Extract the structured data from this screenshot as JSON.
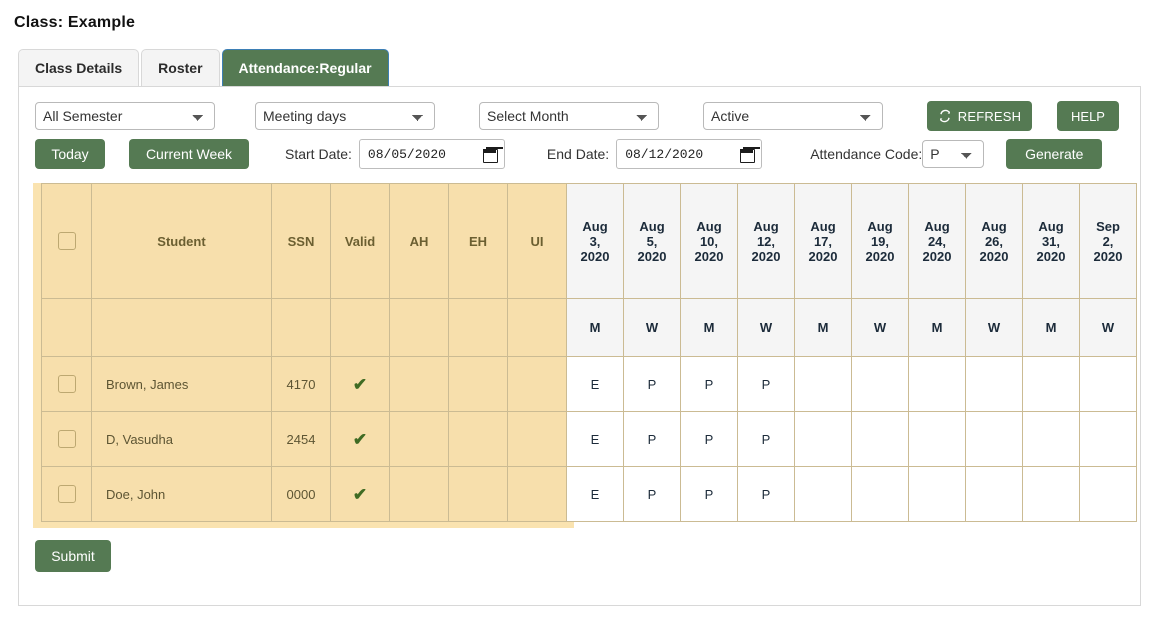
{
  "page": {
    "title": "Class: Example"
  },
  "tabs": [
    {
      "label": "Class Details",
      "active": false
    },
    {
      "label": "Roster",
      "active": false
    },
    {
      "label": "Attendance:Regular",
      "active": true
    }
  ],
  "toolbar": {
    "semester_select": {
      "value": "All Semester",
      "name": "semester-select"
    },
    "meeting_select": {
      "value": "Meeting days",
      "name": "meeting-days-select"
    },
    "month_select": {
      "value": "Select Month",
      "name": "month-select"
    },
    "status_select": {
      "value": "Active",
      "name": "status-select"
    },
    "refresh_label": "REFRESH",
    "refresh_icon": "refresh-icon",
    "help_label": "HELP",
    "today_label": "Today",
    "current_week_label": "Current Week",
    "start_date_label": "Start Date:",
    "start_date_value": "08/05/2020",
    "end_date_label": "End Date:",
    "end_date_value": "08/12/2020",
    "attendance_code_label": "Attendance Code:",
    "attendance_code_value": "P",
    "generate_label": "Generate",
    "calendar_icon": "calendar-icon"
  },
  "table": {
    "columns": {
      "check": "",
      "student": "Student",
      "ssn": "SSN",
      "valid": "Valid",
      "ah": "AH",
      "eh": "EH",
      "ui": "UI"
    },
    "date_columns": [
      {
        "month": "Aug",
        "day": "3,",
        "year": "2020",
        "weekday": "M"
      },
      {
        "month": "Aug",
        "day": "5,",
        "year": "2020",
        "weekday": "W"
      },
      {
        "month": "Aug",
        "day": "10,",
        "year": "2020",
        "weekday": "M"
      },
      {
        "month": "Aug",
        "day": "12,",
        "year": "2020",
        "weekday": "W"
      },
      {
        "month": "Aug",
        "day": "17,",
        "year": "2020",
        "weekday": "M"
      },
      {
        "month": "Aug",
        "day": "19,",
        "year": "2020",
        "weekday": "W"
      },
      {
        "month": "Aug",
        "day": "24,",
        "year": "2020",
        "weekday": "M"
      },
      {
        "month": "Aug",
        "day": "26,",
        "year": "2020",
        "weekday": "W"
      },
      {
        "month": "Aug",
        "day": "31,",
        "year": "2020",
        "weekday": "M"
      },
      {
        "month": "Sep",
        "day": "2,",
        "year": "2020",
        "weekday": "W"
      }
    ],
    "rows": [
      {
        "student": "Brown, James",
        "ssn": "4170",
        "valid": "✔",
        "ah": "",
        "eh": "",
        "ui": "",
        "attendance": [
          "E",
          "P",
          "P",
          "P",
          "",
          "",
          "",
          "",
          "",
          ""
        ]
      },
      {
        "student": "D, Vasudha",
        "ssn": "2454",
        "valid": "✔",
        "ah": "",
        "eh": "",
        "ui": "",
        "attendance": [
          "E",
          "P",
          "P",
          "P",
          "",
          "",
          "",
          "",
          "",
          ""
        ]
      },
      {
        "student": "Doe, John",
        "ssn": "0000",
        "valid": "✔",
        "ah": "",
        "eh": "",
        "ui": "",
        "attendance": [
          "E",
          "P",
          "P",
          "P",
          "",
          "",
          "",
          "",
          "",
          ""
        ]
      }
    ]
  },
  "footer": {
    "submit_label": "Submit"
  },
  "colors": {
    "brand_green": "#557a53",
    "tan_panel": "#fae3b0",
    "tan_cell": "#f7dfac",
    "active_tab_border": "#3d7fb5",
    "check_green": "#3f6b23"
  }
}
